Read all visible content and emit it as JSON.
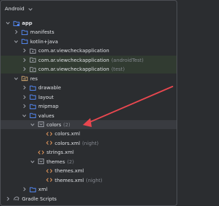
{
  "header": {
    "title": "Android"
  },
  "tree": [
    {
      "label": "app",
      "hint": "",
      "icon": "folder-module-icon",
      "depth": 0,
      "expand": "open",
      "bold": true,
      "hl": ""
    },
    {
      "label": "manifests",
      "hint": "",
      "icon": "folder-icon",
      "depth": 1,
      "expand": "closed",
      "bold": false,
      "hl": ""
    },
    {
      "label": "kotlin+java",
      "hint": "",
      "icon": "folder-source-icon",
      "depth": 1,
      "expand": "open",
      "bold": false,
      "hl": ""
    },
    {
      "label": "com.ar.viewcheckapplication",
      "hint": "",
      "icon": "package-icon",
      "depth": 2,
      "expand": "closed",
      "bold": false,
      "hl": ""
    },
    {
      "label": "com.ar.viewcheckapplication",
      "hint": "(androidTest)",
      "icon": "package-icon",
      "depth": 2,
      "expand": "closed",
      "bold": false,
      "hl": "gen"
    },
    {
      "label": "com.ar.viewcheckapplication",
      "hint": "(test)",
      "icon": "package-icon",
      "depth": 2,
      "expand": "closed",
      "bold": false,
      "hl": "gen"
    },
    {
      "label": "res",
      "hint": "",
      "icon": "folder-res-icon",
      "depth": 1,
      "expand": "open",
      "bold": false,
      "hl": ""
    },
    {
      "label": "drawable",
      "hint": "",
      "icon": "folder-icon",
      "depth": 2,
      "expand": "closed",
      "bold": false,
      "hl": ""
    },
    {
      "label": "layout",
      "hint": "",
      "icon": "folder-icon",
      "depth": 2,
      "expand": "closed",
      "bold": false,
      "hl": ""
    },
    {
      "label": "mipmap",
      "hint": "",
      "icon": "folder-icon",
      "depth": 2,
      "expand": "closed",
      "bold": false,
      "hl": ""
    },
    {
      "label": "values",
      "hint": "",
      "icon": "folder-icon",
      "depth": 2,
      "expand": "open",
      "bold": false,
      "hl": ""
    },
    {
      "label": "colors",
      "hint": "(2)",
      "icon": "resource-group-icon",
      "depth": 3,
      "expand": "open",
      "bold": false,
      "hl": "sel"
    },
    {
      "label": "colors.xml",
      "hint": "",
      "icon": "xml-file-icon",
      "depth": 4,
      "expand": "none",
      "bold": false,
      "hl": ""
    },
    {
      "label": "colors.xml",
      "hint": "(night)",
      "icon": "xml-file-icon",
      "depth": 4,
      "expand": "none",
      "bold": false,
      "hl": ""
    },
    {
      "label": "strings.xml",
      "hint": "",
      "icon": "xml-file-icon",
      "depth": 3,
      "expand": "none",
      "bold": false,
      "hl": ""
    },
    {
      "label": "themes",
      "hint": "(2)",
      "icon": "resource-group-icon",
      "depth": 3,
      "expand": "open",
      "bold": false,
      "hl": ""
    },
    {
      "label": "themes.xml",
      "hint": "",
      "icon": "xml-file-icon",
      "depth": 4,
      "expand": "none",
      "bold": false,
      "hl": ""
    },
    {
      "label": "themes.xml",
      "hint": "(night)",
      "icon": "xml-file-icon",
      "depth": 4,
      "expand": "none",
      "bold": false,
      "hl": ""
    },
    {
      "label": "xml",
      "hint": "",
      "icon": "folder-icon",
      "depth": 2,
      "expand": "closed",
      "bold": false,
      "hl": ""
    },
    {
      "label": "Gradle Scripts",
      "hint": "",
      "icon": "gradle-icon",
      "depth": 0,
      "expand": "closed",
      "bold": false,
      "hl": ""
    }
  ],
  "colors": {
    "folder": "#548af7",
    "folder_source": "#548af7",
    "folder_res": "#c9a26d",
    "xml": "#e0955b",
    "arrow": "#e8474f"
  }
}
